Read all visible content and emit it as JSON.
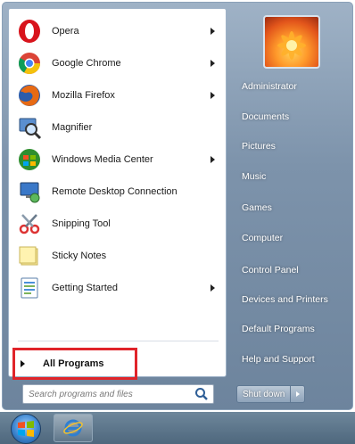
{
  "programs": [
    {
      "label": "Opera",
      "icon": "opera-icon",
      "has_submenu": true
    },
    {
      "label": "Google Chrome",
      "icon": "chrome-icon",
      "has_submenu": true
    },
    {
      "label": "Mozilla Firefox",
      "icon": "firefox-icon",
      "has_submenu": true
    },
    {
      "label": "Magnifier",
      "icon": "magnifier-icon",
      "has_submenu": false
    },
    {
      "label": "Windows Media Center",
      "icon": "media-center-icon",
      "has_submenu": true
    },
    {
      "label": "Remote Desktop Connection",
      "icon": "remote-desktop-icon",
      "has_submenu": false
    },
    {
      "label": "Snipping Tool",
      "icon": "scissors-icon",
      "has_submenu": false
    },
    {
      "label": "Sticky Notes",
      "icon": "sticky-notes-icon",
      "has_submenu": false
    },
    {
      "label": "Getting Started",
      "icon": "getting-started-icon",
      "has_submenu": true
    }
  ],
  "all_programs": {
    "label": "All Programs",
    "highlight_color": "#e0242a"
  },
  "search": {
    "placeholder": "Search programs and files"
  },
  "right_pane": {
    "items": [
      "Administrator",
      "Documents",
      "Pictures",
      "Music",
      "Games",
      "Computer",
      "Control Panel",
      "Devices and Printers",
      "Default Programs",
      "Help and Support"
    ]
  },
  "shutdown": {
    "label": "Shut down"
  },
  "colors": {
    "menu_right_bg": "#7d93ab",
    "highlight_box": "#e0242a",
    "taskbar": "#4e677d"
  }
}
